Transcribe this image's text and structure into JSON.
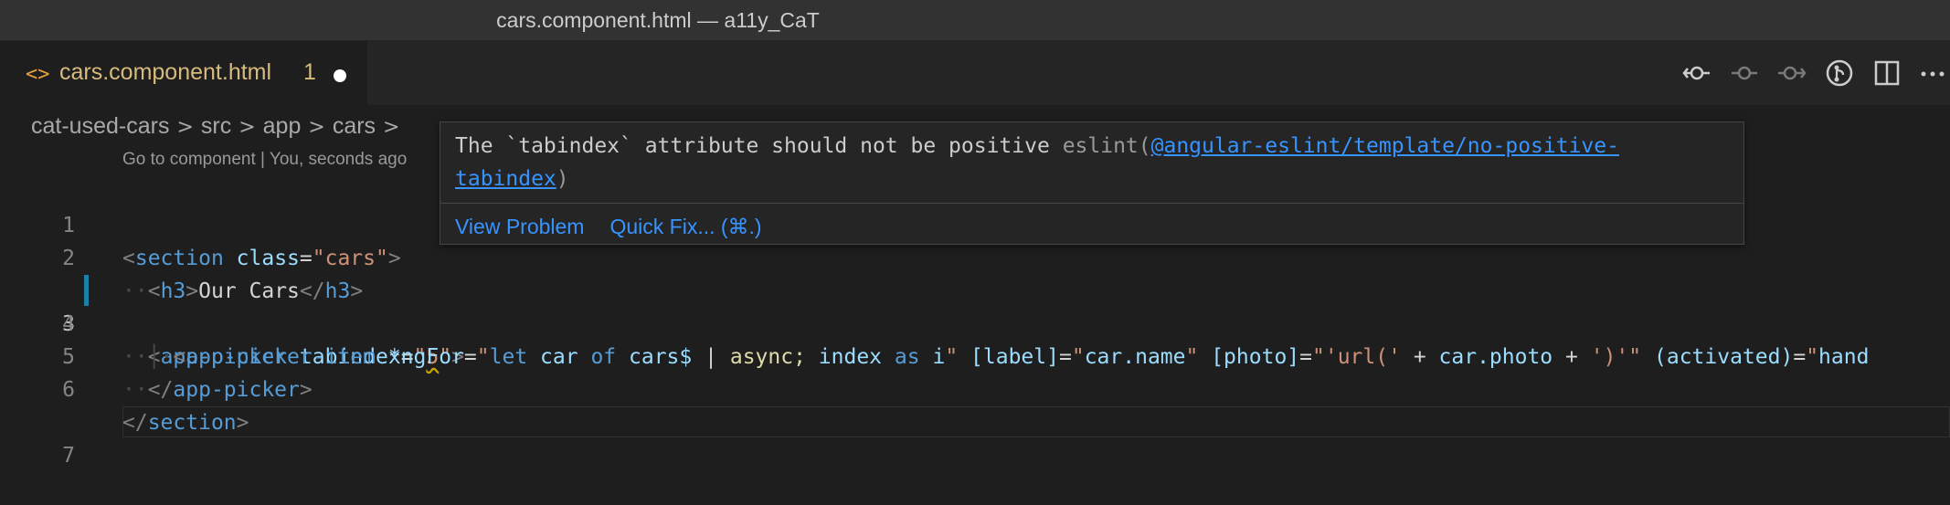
{
  "window": {
    "title": "cars.component.html — a11y_CaT"
  },
  "tab": {
    "icon": "html-file-icon",
    "name": "cars.component.html",
    "problems": "1"
  },
  "actions": [
    "git-commit-icon",
    "git-previous-icon",
    "git-next-icon",
    "git-blame-icon",
    "split-editor-icon",
    "more-icon"
  ],
  "breadcrumb": [
    "cat-used-cars",
    "src",
    "app",
    "cars"
  ],
  "codelens": "Go to component | You, seconds ago",
  "lines": [
    "1",
    "2",
    "3",
    "4",
    "5",
    "6",
    "7"
  ],
  "code": {
    "l1": {
      "tag": "section",
      "attr": "class",
      "val": "\"cars\""
    },
    "l2": {
      "tag": "h3",
      "text": "Our Cars"
    },
    "l3": {
      "tag": "app-picker",
      "attr": "tabindex",
      "val_open": "\"",
      "val_num": "5",
      "val_close": "\""
    },
    "l4": {
      "tag": "app-picker-item",
      "attr1": "*ngFor",
      "v_let": "let",
      "v_car": "car",
      "v_of": "of",
      "v_cars": "cars$",
      "v_pipe": "|",
      "v_async": "async;",
      "v_index": "index",
      "v_as": "as",
      "v_i": "i",
      "attr2": "[label]",
      "v_label": "car.name",
      "attr3": "[photo]",
      "v_url": "'url('",
      "v_plus1": "+",
      "v_photo": "car.photo",
      "v_plus2": "+",
      "v_close": "')'",
      "attr4": "(activated)",
      "v_hand": "hand"
    },
    "l5": {
      "tag": "app-picker"
    },
    "l6": {
      "tag": "section"
    }
  },
  "hover": {
    "message": "The `tabindex` attribute should not be positive",
    "source": "eslint(",
    "rule_a": "@angular-eslint/template/no-positive-",
    "rule_b": "tabindex",
    "source_close": ")",
    "view_problem": "View Problem",
    "quick_fix": "Quick Fix... (⌘.)"
  }
}
